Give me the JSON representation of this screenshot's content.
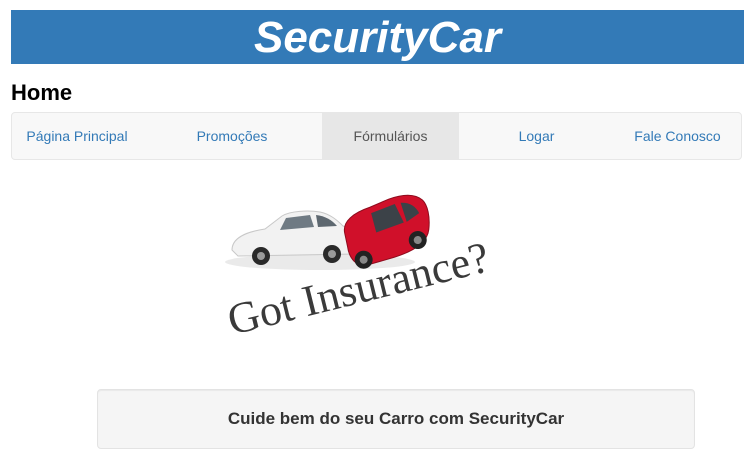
{
  "header": {
    "brand": "SecurityCar"
  },
  "page": {
    "heading": "Home"
  },
  "nav": {
    "items": [
      {
        "label": "Página Principal",
        "active": false
      },
      {
        "label": "Promoções",
        "active": false
      },
      {
        "label": "Fórmulários",
        "active": true
      },
      {
        "label": "Logar",
        "active": false
      },
      {
        "label": "Fale Conosco",
        "active": false
      }
    ]
  },
  "hero": {
    "caption": "Got Insurance?"
  },
  "callout": {
    "text": "Cuide bem do seu Carro com SecurityCar"
  },
  "colors": {
    "brand": "#337ab7",
    "white_car": "#f2f2f2",
    "red_car": "#d0102a"
  }
}
